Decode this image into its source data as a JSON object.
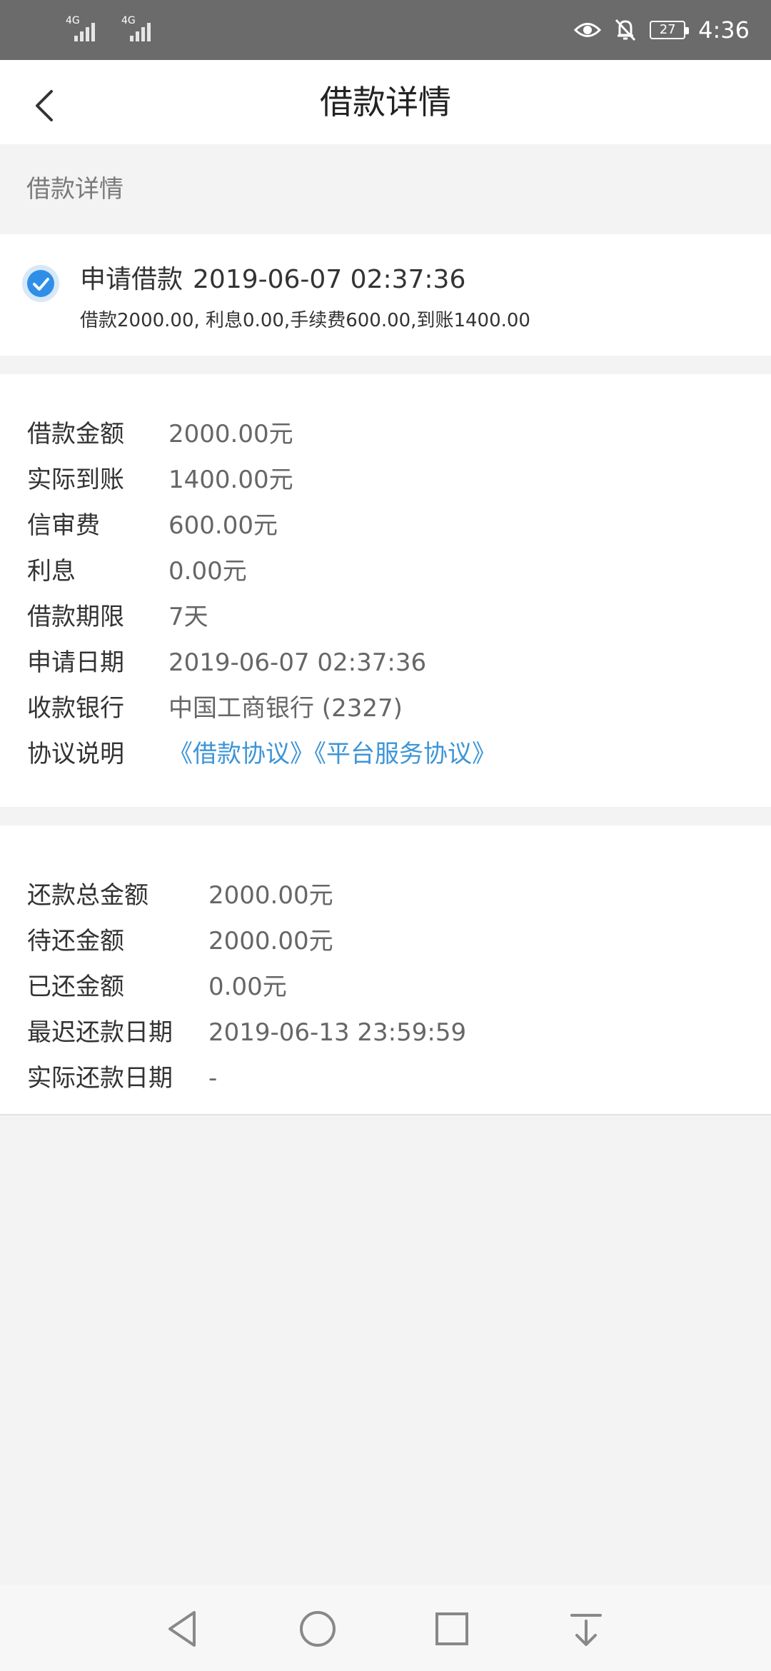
{
  "status_bar": {
    "signal_tag_1": "4G",
    "signal_tag_2": "4G",
    "battery": "27",
    "time": "4:36"
  },
  "app_bar": {
    "title": "借款详情"
  },
  "section_header": "借款详情",
  "event": {
    "title": "申请借款",
    "date": "2019-06-07 02:37:36",
    "summary": "借款2000.00, 利息0.00,手续费600.00,到账1400.00"
  },
  "details": [
    {
      "label": "借款金额",
      "value": "2000.00元"
    },
    {
      "label": "实际到账",
      "value": "1400.00元"
    },
    {
      "label": "信审费",
      "value": "600.00元"
    },
    {
      "label": "利息",
      "value": "0.00元"
    },
    {
      "label": "借款期限",
      "value": "7天"
    },
    {
      "label": "申请日期",
      "value": "2019-06-07 02:37:36"
    },
    {
      "label": "收款银行",
      "value": "中国工商银行 (2327)"
    }
  ],
  "agreement": {
    "label": "协议说明",
    "link1": "《借款协议》",
    "link2": "《平台服务协议》"
  },
  "repayment": [
    {
      "label": "还款总金额",
      "value": "2000.00元"
    },
    {
      "label": "待还金额",
      "value": "2000.00元"
    },
    {
      "label": "已还金额",
      "value": "0.00元"
    },
    {
      "label": "最迟还款日期",
      "value": "2019-06-13 23:59:59"
    },
    {
      "label": "实际还款日期",
      "value": "-"
    }
  ],
  "colors": {
    "accent": "#3d95d6",
    "check": "#2f8fe8",
    "status_bar": "#6b6b6b"
  },
  "icons": [
    "back-arrow-icon",
    "check-circle-icon",
    "eye-icon",
    "bell-off-icon",
    "nav-back-icon",
    "nav-home-icon",
    "nav-recents-icon",
    "nav-download-icon"
  ]
}
